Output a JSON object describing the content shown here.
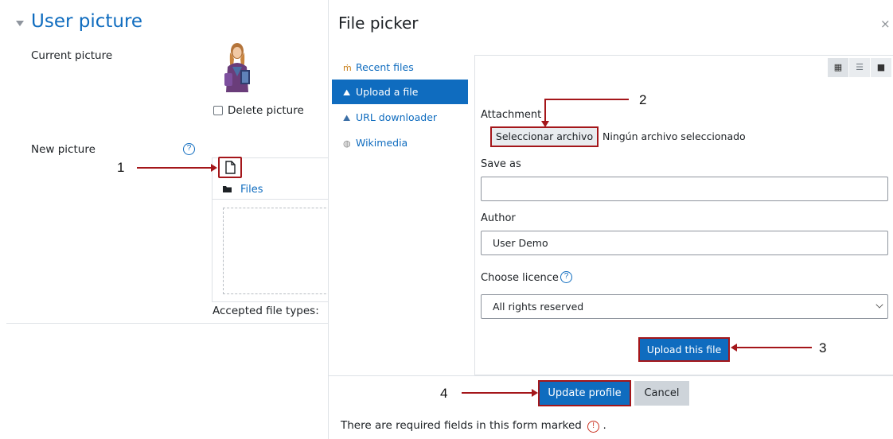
{
  "profile": {
    "section_title": "User picture",
    "current_picture_label": "Current picture",
    "delete_picture_label": "Delete picture",
    "new_picture_label": "New picture",
    "files_folder_label": "Files",
    "accepted_types_label": "Accepted file types:",
    "help_glyph": "?"
  },
  "dialog": {
    "title": "File picker",
    "close_glyph": "×",
    "repositories": [
      {
        "label": "Recent files",
        "icon": "recent-files-icon",
        "active": false
      },
      {
        "label": "Upload a file",
        "icon": "upload-icon",
        "active": true
      },
      {
        "label": "URL downloader",
        "icon": "url-downloader-icon",
        "active": false
      },
      {
        "label": "Wikimedia",
        "icon": "wikimedia-icon",
        "active": false
      }
    ],
    "view_buttons": [
      "icons-view-icon",
      "list-view-icon",
      "tree-view-icon"
    ],
    "attachment_label": "Attachment",
    "choose_file_button": "Seleccionar archivo",
    "no_file_text": "Ningún archivo seleccionado",
    "save_as_label": "Save as",
    "save_as_value": "",
    "author_label": "Author",
    "author_value": "User Demo",
    "licence_label": "Choose licence",
    "licence_value": "All rights reserved",
    "upload_button": "Upload this file"
  },
  "footer": {
    "update_profile_button": "Update profile",
    "cancel_button": "Cancel",
    "required_text": "There are required fields in this form marked",
    "required_suffix": ".",
    "required_glyph": "!"
  },
  "annotations": {
    "step1": "1",
    "step2": "2",
    "step3": "3",
    "step4": "4"
  },
  "colors": {
    "accent": "#0f6cbf",
    "highlight": "#a4161a",
    "required": "#ca3120"
  }
}
